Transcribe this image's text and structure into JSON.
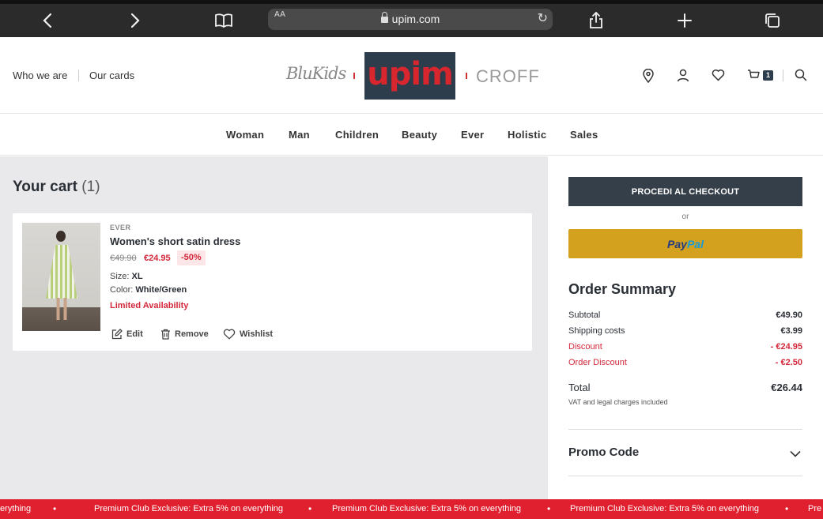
{
  "browser": {
    "url": "upim.com",
    "text_size_label": "AA"
  },
  "header": {
    "links": [
      "Who we are",
      "Our cards"
    ],
    "logos": {
      "left": "BluKids",
      "center": "upim",
      "right": "CROFF"
    },
    "icons": [
      "location-icon",
      "user-icon",
      "heart-icon",
      "cart-icon",
      "search-icon"
    ],
    "cart_count": "1"
  },
  "nav": {
    "items": [
      "Woman",
      "Man",
      "Children",
      "Beauty",
      "Ever",
      "Holistic",
      "Sales"
    ]
  },
  "cart": {
    "title": "Your cart",
    "count": "(1)",
    "item": {
      "brand": "EVER",
      "name": "Women's short satin dress",
      "price_old": "€49.90",
      "price_new": "€24.95",
      "discount": "-50%",
      "size_label": "Size:",
      "size": "XL",
      "color_label": "Color:",
      "color": "White/Green",
      "availability": "Limited Availability",
      "actions": {
        "edit": "Edit",
        "remove": "Remove",
        "wishlist": "Wishlist"
      }
    }
  },
  "summary": {
    "checkout_label": "PROCEDI AL CHECKOUT",
    "or_label": "or",
    "paypal_part1": "Pay",
    "paypal_part2": "Pal",
    "title": "Order Summary",
    "rows": [
      {
        "label": "Subtotal",
        "value": "€49.90"
      },
      {
        "label": "Shipping costs",
        "value": "€3.99"
      },
      {
        "label": "Discount",
        "value": "- €24.95"
      },
      {
        "label": "Order Discount",
        "value": "- €2.50"
      }
    ],
    "total_label": "Total",
    "total_value": "€26.44",
    "vat_note": "VAT and legal charges included",
    "promo_label": "Promo Code"
  },
  "ticker": {
    "messages": [
      "erything",
      "Premium Club Exclusive: Extra 5% on everything",
      "Premium Club Exclusive: Extra 5% on everything",
      "Premium Club Exclusive: Extra 5% on everything",
      "Pre"
    ]
  },
  "colors": {
    "brand_dark": "#2e3d4c",
    "brand_red": "#d8262e",
    "sale_red": "#d3283a",
    "paypal_yellow": "#d3a11d",
    "ticker_red": "#e0202f"
  }
}
